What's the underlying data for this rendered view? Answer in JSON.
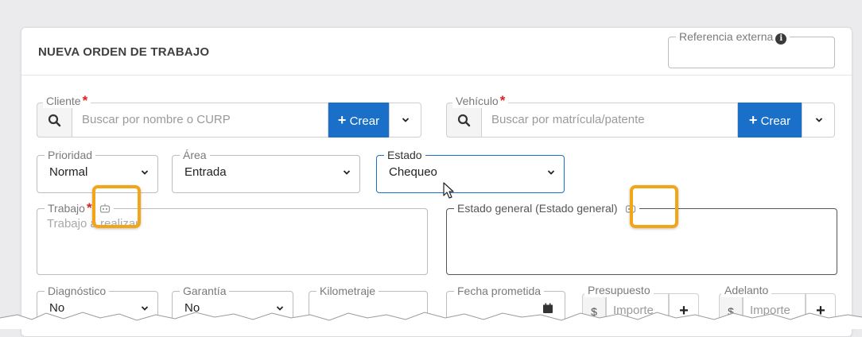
{
  "form": {
    "title": "NUEVA ORDEN DE TRABAJO",
    "referencia_label": "Referencia externa",
    "cliente": {
      "label": "Cliente",
      "required_mark": "*",
      "placeholder": "Buscar por nombre o CURP",
      "crear_label": "Crear"
    },
    "vehiculo": {
      "label": "Vehículo",
      "required_mark": "*",
      "placeholder": "Buscar por matrícula/patente",
      "crear_label": "Crear"
    },
    "prioridad": {
      "label": "Prioridad",
      "value": "Normal"
    },
    "area": {
      "label": "Área",
      "value": "Entrada"
    },
    "estado": {
      "label": "Estado",
      "value": "Chequeo"
    },
    "trabajo": {
      "label": "Trabajo",
      "required_mark": "*",
      "placeholder": "Trabajo a realizar"
    },
    "estado_general": {
      "label": "Estado general (Estado general)"
    },
    "diagnostico": {
      "label": "Diagnóstico",
      "value": "No"
    },
    "garantia": {
      "label": "Garantía",
      "value": "No"
    },
    "kilometraje": {
      "label": "Kilometraje"
    },
    "fecha_prometida": {
      "label": "Fecha prometida"
    },
    "presupuesto": {
      "label": "Presupuesto",
      "currency": "$",
      "placeholder": "Importe",
      "add": "+"
    },
    "adelanto": {
      "label": "Adelanto",
      "currency": "$",
      "placeholder": "Importe",
      "add": "+"
    }
  },
  "colors": {
    "primary": "#1a6fc9",
    "highlight": "#f2a516",
    "required": "#e02020",
    "focus": "#1a6fc9"
  }
}
